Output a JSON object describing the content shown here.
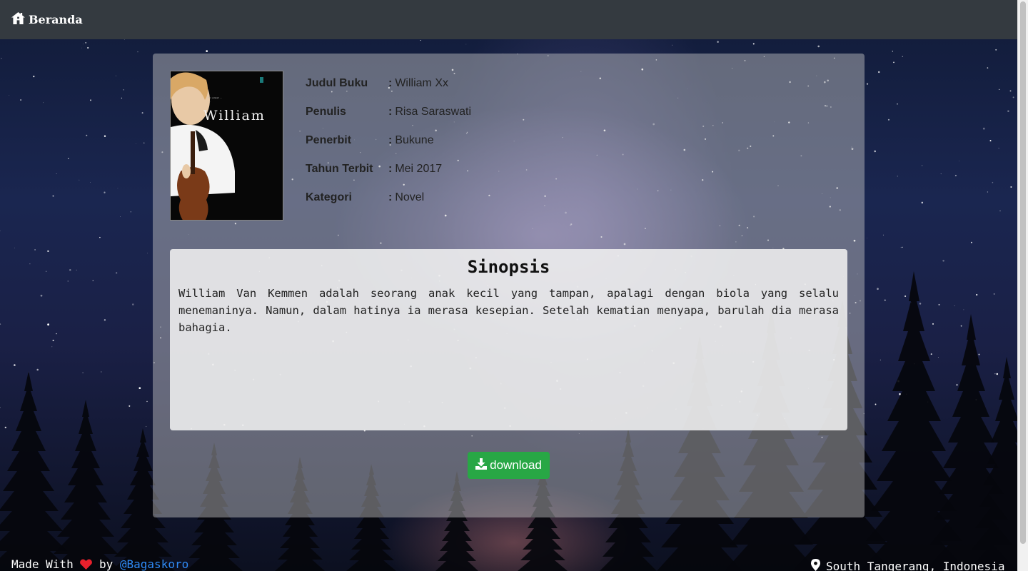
{
  "navbar": {
    "brand_label": "Beranda"
  },
  "book": {
    "cover_title": "William",
    "fields": [
      {
        "label": "Judul Buku",
        "value": "William Xx"
      },
      {
        "label": "Penulis",
        "value": "Risa Saraswati"
      },
      {
        "label": "Penerbit",
        "value": "Bukune"
      },
      {
        "label": "Tahun Terbit",
        "value": "Mei 2017"
      },
      {
        "label": "Kategori",
        "value": "Novel"
      }
    ],
    "colon": ":"
  },
  "sinopsis": {
    "heading": "Sinopsis",
    "text": "William Van Kemmen adalah seorang anak kecil yang tampan, apalagi dengan biola yang selalu menemaninya. Namun, dalam hatinya ia merasa kesepian. Setelah kematian menyapa, barulah dia merasa bahagia."
  },
  "download_button": {
    "label": "download",
    "color": "#28a745"
  },
  "footer": {
    "made_with": "Made With",
    "by": "by",
    "author_link": "@Bagaskoro",
    "location": "South Tangerang, Indonesia"
  },
  "colors": {
    "navbar": "#343a40",
    "link": "#2f8af5",
    "heart": "#e8202c"
  }
}
